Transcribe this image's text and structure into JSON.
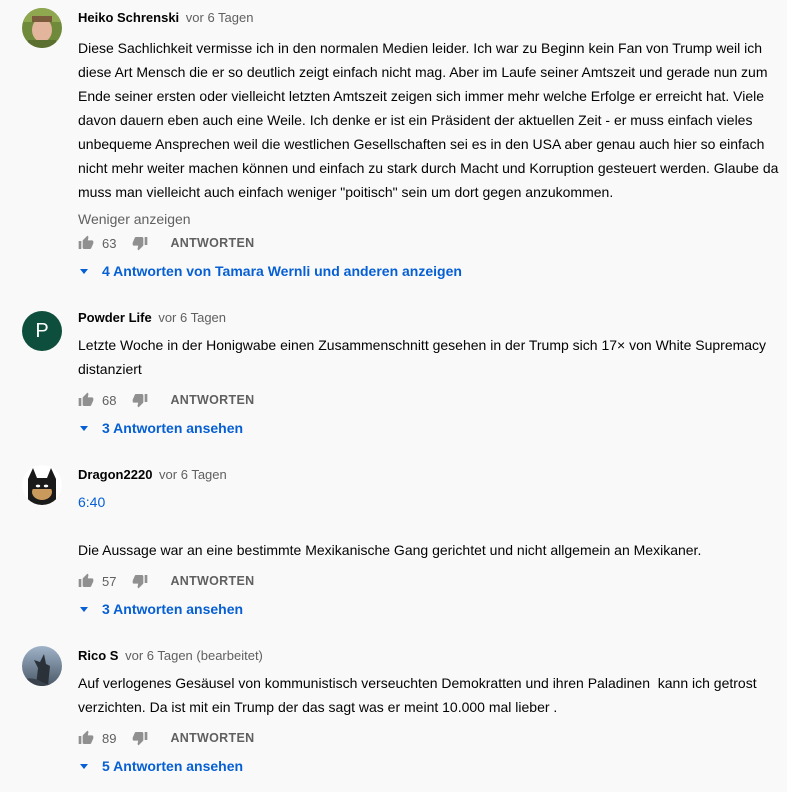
{
  "comments": [
    {
      "author": "Heiko Schrenski",
      "time": "vor 6 Tagen",
      "text": "Diese Sachlichkeit vermisse ich in den normalen Medien leider. Ich war zu Beginn kein Fan von Trump weil ich diese Art Mensch die er so deutlich zeigt einfach nicht mag. Aber im Laufe seiner Amtszeit und gerade nun zum Ende seiner ersten oder vielleicht letzten Amtszeit zeigen sich immer mehr welche Erfolge er erreicht hat. Viele davon dauern eben auch eine Weile. Ich denke er ist ein Präsident der aktuellen Zeit - er muss einfach vieles unbequeme Ansprechen weil die westlichen Gesellschaften sei es in den USA aber genau auch hier so einfach nicht mehr weiter machen können und einfach zu stark durch Macht und Korruption gesteuert werden. Glaube da muss man vielleicht auch einfach weniger \"poitisch\" sein um dort gegen anzukommen.",
      "show_less": "Weniger anzeigen",
      "likes": "63",
      "reply_label": "ANTWORTEN",
      "replies_label": "4 Antworten von Tamara Wernli und anderen anzeigen"
    },
    {
      "author": "Powder Life",
      "time": "vor 6 Tagen",
      "avatar_letter": "P",
      "avatar_color": "#0d4f3c",
      "text": "Letzte Woche in der Honigwabe einen Zusammenschnitt gesehen in der Trump sich 17× von White Supremacy distanziert",
      "likes": "68",
      "reply_label": "ANTWORTEN",
      "replies_label": "3 Antworten ansehen"
    },
    {
      "author": "Dragon2220",
      "time": "vor 6 Tagen",
      "timestamp_link": "6:40",
      "text": "Die Aussage war an eine bestimmte Mexikanische Gang gerichtet und nicht allgemein an Mexikaner.",
      "likes": "57",
      "reply_label": "ANTWORTEN",
      "replies_label": "3 Antworten ansehen"
    },
    {
      "author": "Rico S",
      "time": "vor 6 Tagen (bearbeitet)",
      "text": "Auf verlogenes Gesäusel von kommunistisch verseuchten Demokratten und ihren Paladinen  kann ich getrost verzichten. Da ist mit ein Trump der das sagt was er meint 10.000 mal lieber .",
      "likes": "89",
      "reply_label": "ANTWORTEN",
      "replies_label": "5 Antworten ansehen"
    }
  ],
  "colors": {
    "link": "#065fd4",
    "meta": "#606060",
    "text": "#030303",
    "background": "#f9f9f9"
  },
  "icons": {
    "like": "thumb-up-icon",
    "dislike": "thumb-down-icon",
    "expand": "caret-down-icon"
  }
}
